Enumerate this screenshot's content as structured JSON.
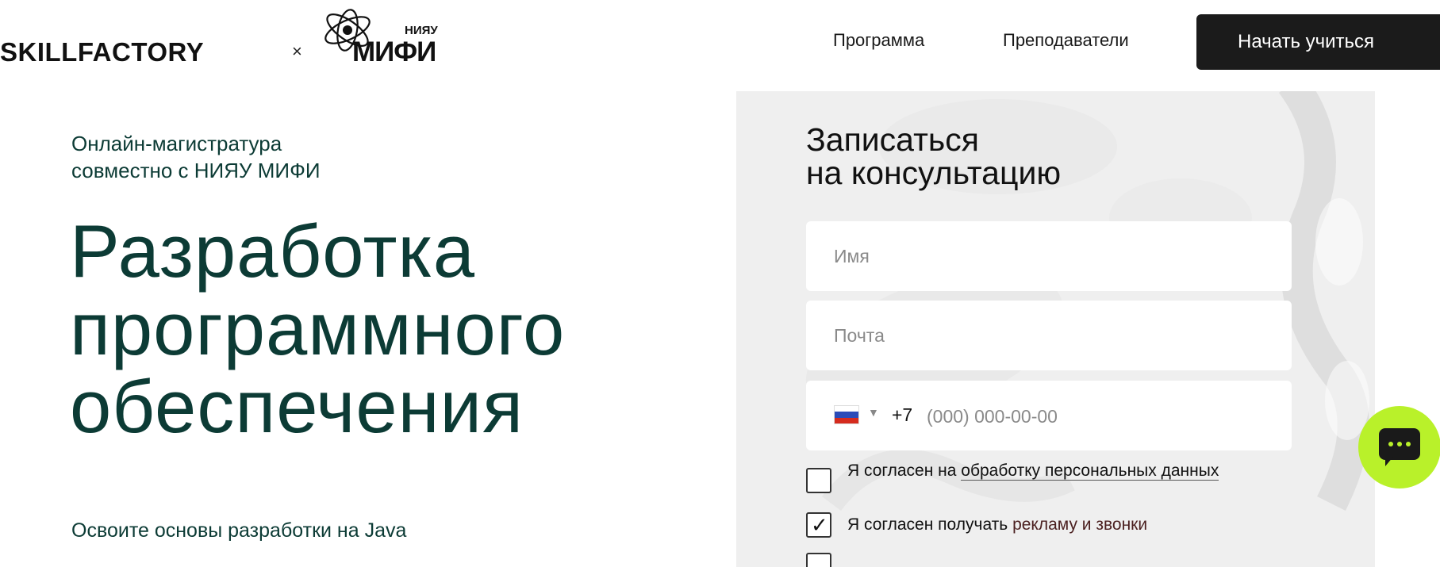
{
  "header": {
    "logo_text": "SKILLFACTORY",
    "separator": "×",
    "partner_small": "НИЯУ",
    "partner_big": "МИФИ",
    "nav": [
      {
        "label": "Программа"
      },
      {
        "label": "Преподаватели"
      }
    ],
    "cta_label": "Начать учиться"
  },
  "hero": {
    "subtitle_line1": "Онлайн-магистратура",
    "subtitle_line2": "совместно с НИЯУ МИФИ",
    "title_line1": "Разработка",
    "title_line2": "программного",
    "title_line3": "обеспечения",
    "description": "Освоите основы разработки на Java"
  },
  "form": {
    "title_line1": "Записаться",
    "title_line2": "на консультацию",
    "name_placeholder": "Имя",
    "email_placeholder": "Почта",
    "phone_code": "+7",
    "phone_placeholder": "(000) 000-00-00",
    "consent1_prefix": "Я согласен на ",
    "consent1_link": "обработку персональных данных",
    "consent1_checked": false,
    "consent2_prefix": "Я согласен получать ",
    "consent2_link": "рекламу и звонки",
    "consent2_checked": true
  },
  "colors": {
    "brand_dark": "#0c3b35",
    "button_bg": "#1b1b1b",
    "chat_accent": "#b9f12a",
    "panel_bg": "#efefef"
  },
  "icons": {
    "flag": "russia-flag-icon",
    "caret": "caret-down-icon",
    "chat": "chat-bubble-icon",
    "atom": "atom-logo-icon"
  }
}
